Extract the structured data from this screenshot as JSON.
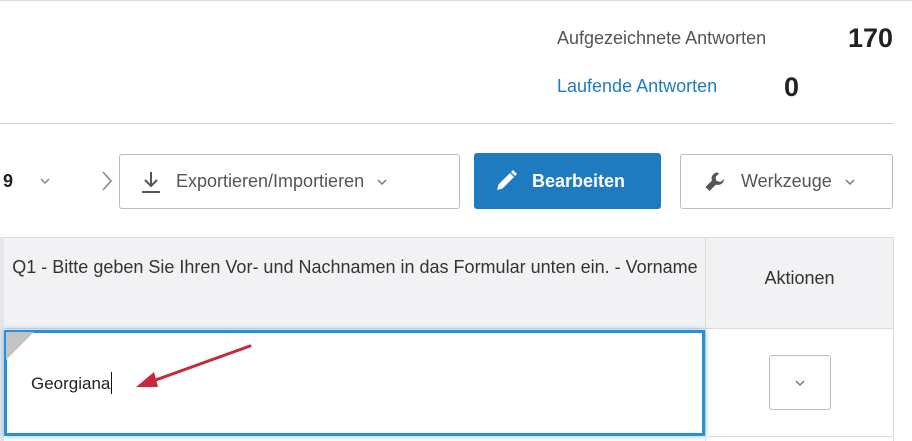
{
  "stats": {
    "recorded_label": "Aufgezeichnete Antworten",
    "recorded_value": "170",
    "in_progress_label": "Laufende Antworten",
    "in_progress_value": "0"
  },
  "toolbar": {
    "page_count": "9",
    "export_label": "Exportieren/Importieren",
    "edit_label": "Bearbeiten",
    "tools_label": "Werkzeuge"
  },
  "table": {
    "columns": [
      "Q1 - Bitte geben Sie Ihren Vor- und Nachnamen in das Formular unten ein. - Vorname",
      "Aktionen"
    ],
    "rows": [
      {
        "q1_value": "Georgiana"
      }
    ]
  },
  "colors": {
    "accent": "#1f7bbf",
    "editor_border": "#2a8fd6",
    "annotation_arrow": "#c62a3a",
    "header_bg": "#f2f2f5"
  },
  "icons": {
    "export": "download-icon",
    "edit": "pencil-icon",
    "tools": "wrench-icon",
    "dropdown": "chevron-down-icon",
    "next": "chevron-right-icon"
  }
}
